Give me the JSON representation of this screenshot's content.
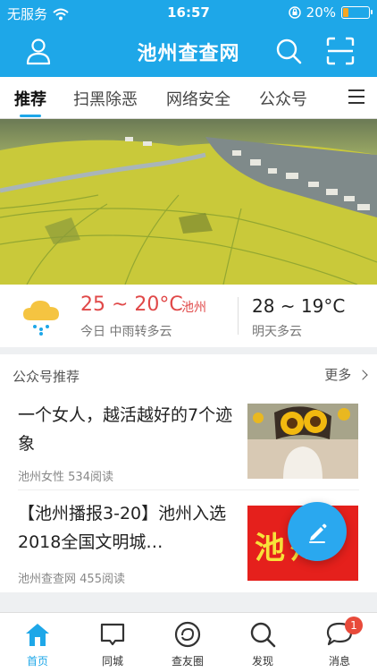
{
  "status_bar": {
    "carrier": "无服务",
    "time": "16:57",
    "battery": "20%",
    "battery_level": 0.2
  },
  "header": {
    "title": "池州查查网",
    "icons": [
      "user-icon",
      "search-icon",
      "scan-icon"
    ]
  },
  "tabs": [
    "推荐",
    "扫黑除恶",
    "网络安全",
    "公众号"
  ],
  "weather": {
    "today_temp": "25 ~ 20°C",
    "city": "池州",
    "today_desc": "今日 中雨转多云",
    "tomorrow_temp": "28 ~ 19°C",
    "tomorrow_desc": "明天多云",
    "icon": "cloud-rain-icon"
  },
  "feed": {
    "heading": "公众号推荐",
    "more": "更多",
    "articles": [
      {
        "title": "一个女人，越活越好的7个迹象",
        "source": "池州女性",
        "reads": "534阅读"
      },
      {
        "title": "【池州播报3-20】池州入选2018全国文明城…",
        "source": "池州查查网",
        "reads": "455阅读",
        "thumb_text": "池州"
      }
    ]
  },
  "tabbar": {
    "items": [
      {
        "label": "首页",
        "icon": "home-icon"
      },
      {
        "label": "同城",
        "icon": "message-square-icon"
      },
      {
        "label": "查友圈",
        "icon": "refresh-circle-icon"
      },
      {
        "label": "发现",
        "icon": "search-icon"
      },
      {
        "label": "消息",
        "icon": "chat-bubble-icon",
        "badge": "1"
      }
    ]
  },
  "colors": {
    "primary": "#1ea7e8",
    "temp_red": "#e04848",
    "badge_red": "#e84a3a"
  }
}
